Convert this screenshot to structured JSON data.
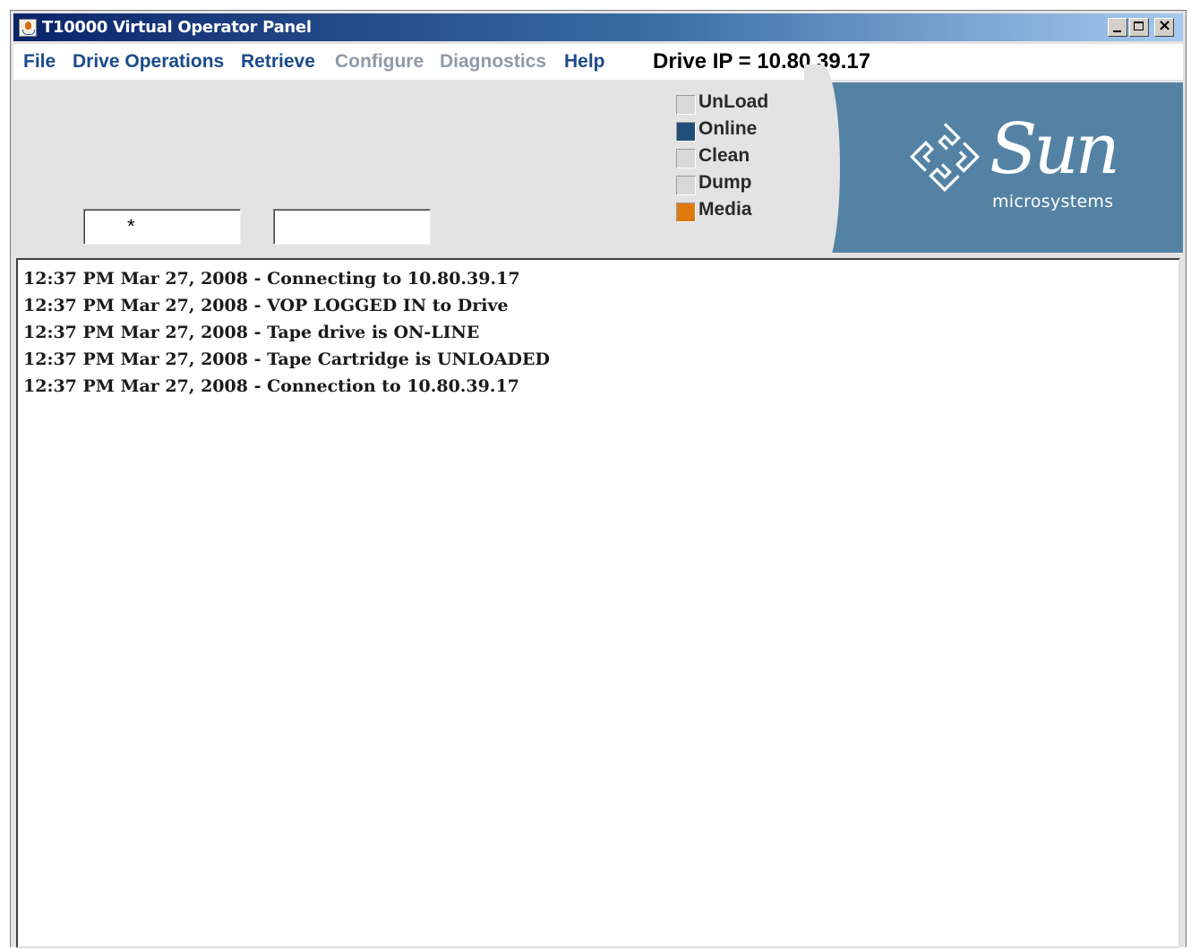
{
  "window": {
    "title": "T10000 Virtual Operator Panel",
    "controls": {
      "minimize": "_",
      "maximize": "□",
      "close": "×"
    }
  },
  "menu": [
    {
      "label": "File",
      "enabled": true
    },
    {
      "label": "Drive Operations",
      "enabled": true
    },
    {
      "label": "Retrieve",
      "enabled": true
    },
    {
      "label": "Configure",
      "enabled": false
    },
    {
      "label": "Diagnostics",
      "enabled": false
    },
    {
      "label": "Help",
      "enabled": true
    }
  ],
  "drive_ip_label": "Drive IP = 10.80.39.17",
  "fields": {
    "field1_value": "*",
    "field2_value": ""
  },
  "indicators": [
    {
      "label": "UnLoad",
      "color": "#d8d8d8"
    },
    {
      "label": "Online",
      "color": "#1f4e78"
    },
    {
      "label": "Clean",
      "color": "#d8d8d8"
    },
    {
      "label": "Dump",
      "color": "#d8d8d8"
    },
    {
      "label": "Media",
      "color": "#e07a10"
    }
  ],
  "logo": {
    "word": "Sun",
    "subtitle": "microsystems"
  },
  "log": [
    "12:37 PM Mar 27, 2008 - Connecting to 10.80.39.17",
    "12:37 PM Mar 27, 2008 - VOP LOGGED IN to Drive",
    "12:37 PM Mar 27, 2008 - Tape drive is ON-LINE",
    "12:37 PM Mar 27, 2008 - Tape Cartridge is UNLOADED",
    "12:37 PM Mar 27, 2008 - Connection to 10.80.39.17"
  ],
  "colors": {
    "title_gradient_start": "#0a246a",
    "title_gradient_end": "#a6caf0",
    "menu_enabled": "#1a4a8a",
    "menu_disabled": "#8f9aa7",
    "logo_panel": "#5482a5"
  }
}
